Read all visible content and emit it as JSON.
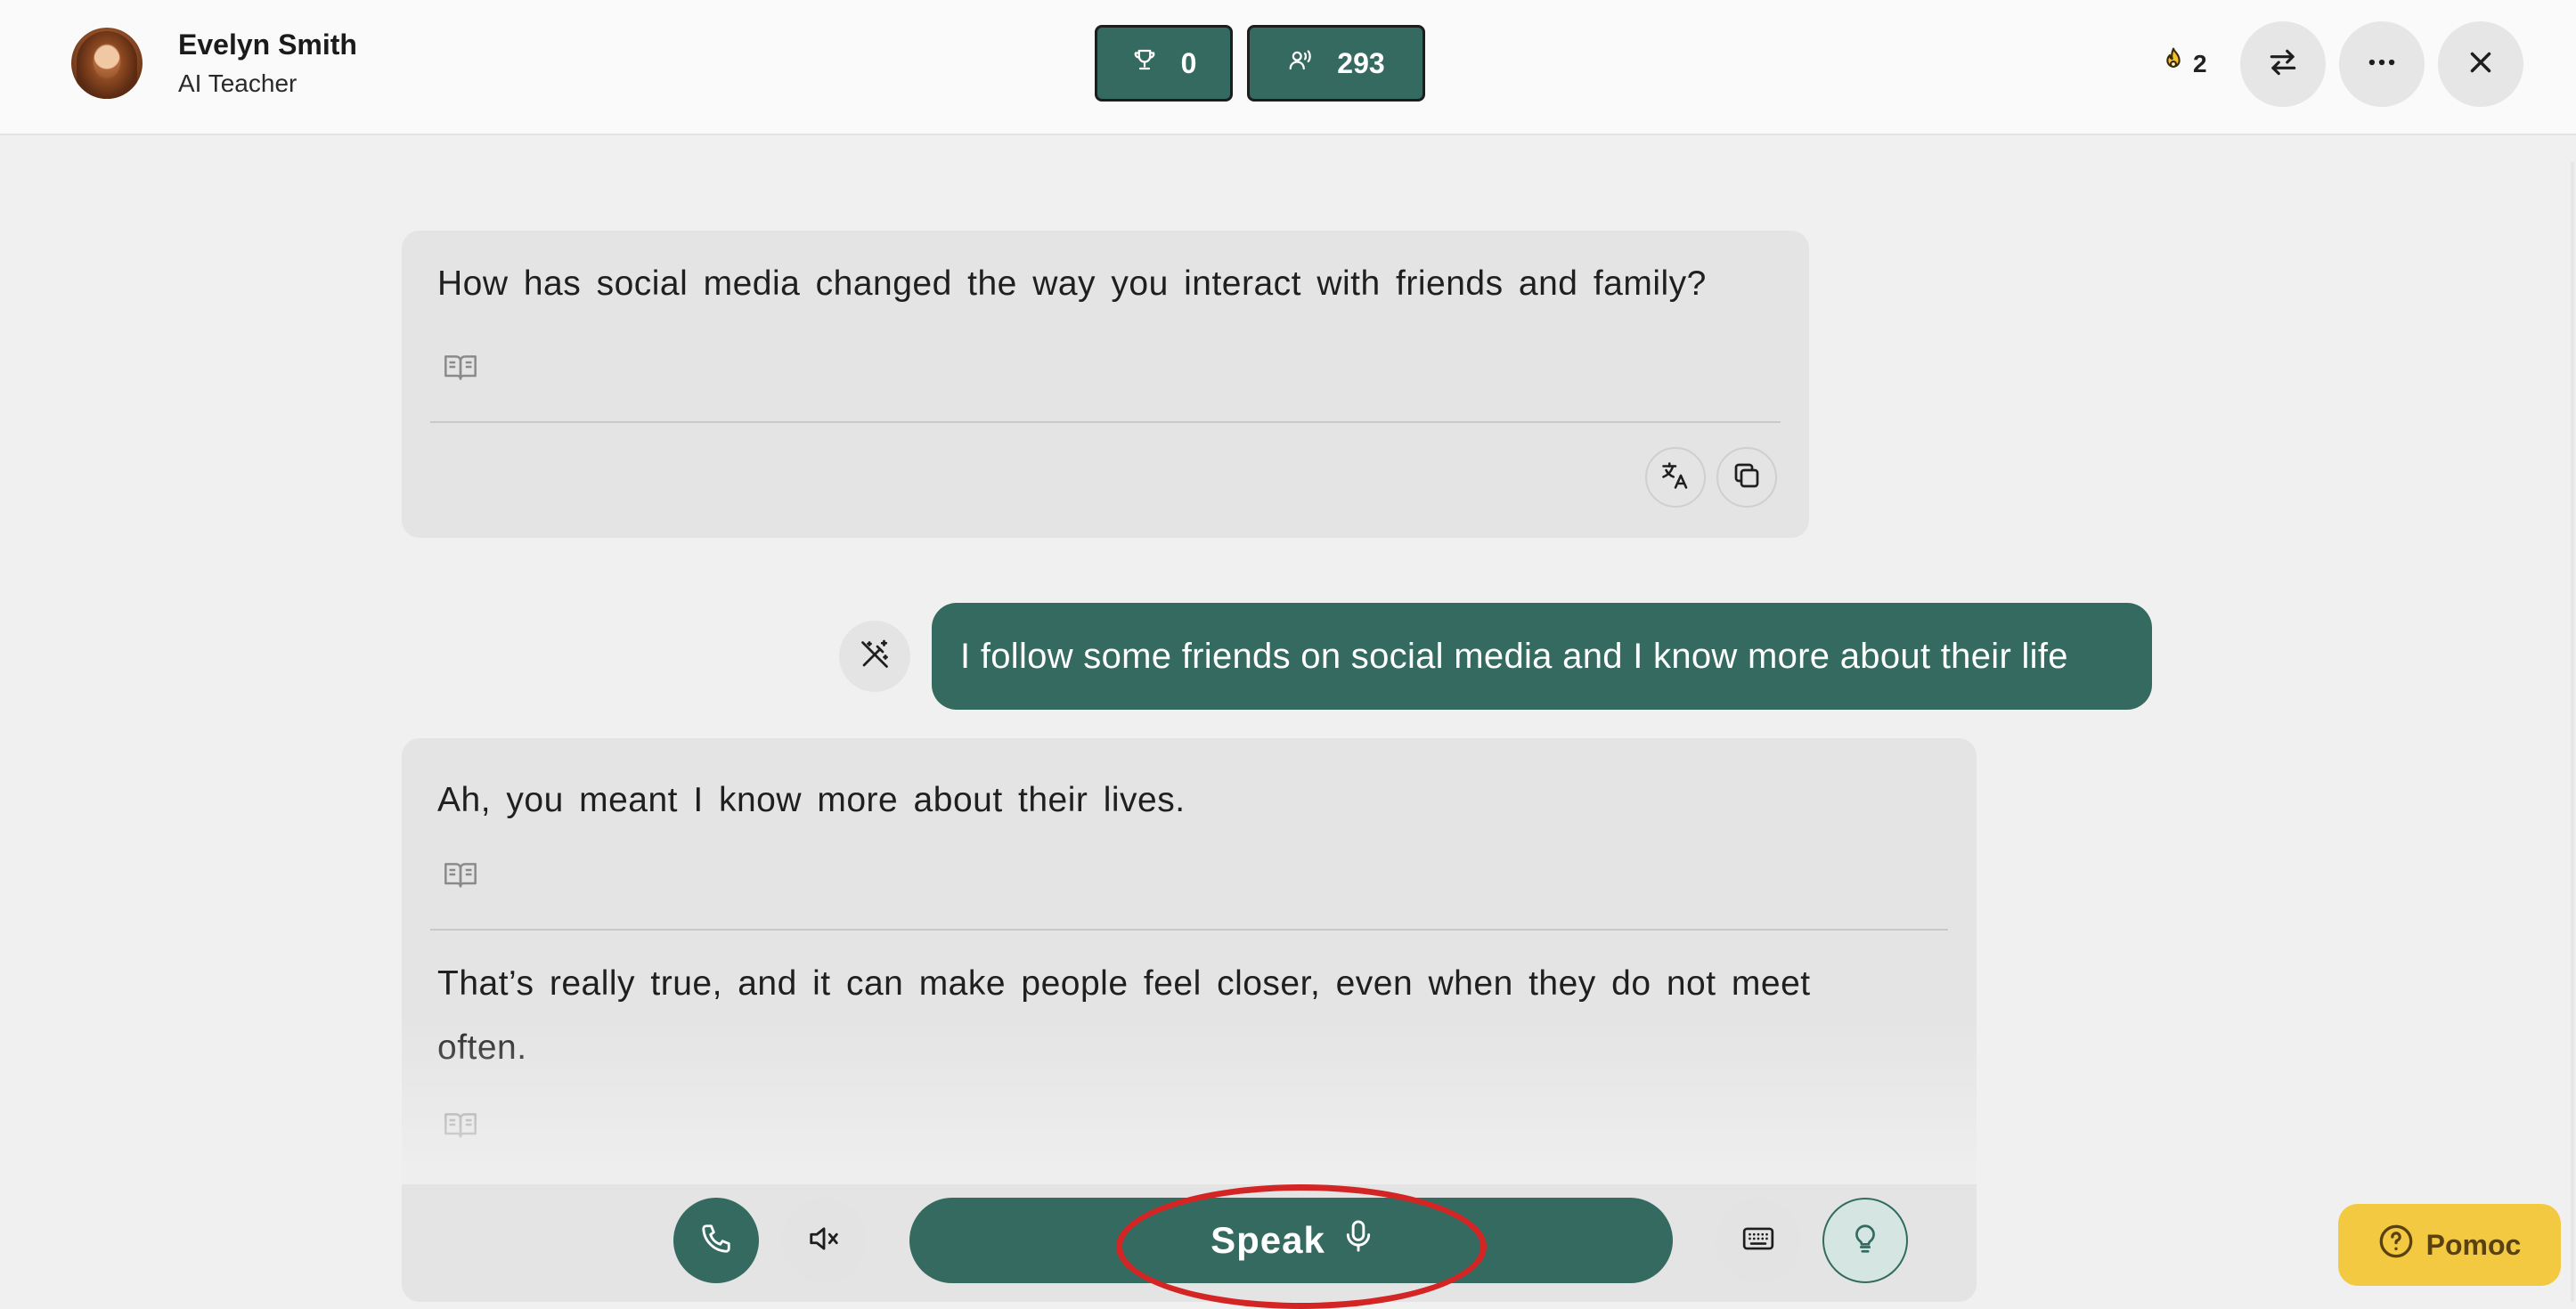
{
  "header": {
    "teacher_name": "Evelyn Smith",
    "teacher_role": "AI Teacher",
    "trophy_count": "0",
    "listen_count": "293",
    "streak_count": "2"
  },
  "chat": {
    "messages": [
      {
        "sender": "ai",
        "paragraphs": [
          "How has social media changed the way you interact with friends and family?"
        ]
      },
      {
        "sender": "user",
        "text": "I follow some friends on social media and I know more about their life"
      },
      {
        "sender": "ai",
        "correction": "Ah, you meant I know more about their lives.",
        "paragraphs": [
          "That’s really true, and it can make people feel closer, even when they do not meet often."
        ]
      }
    ]
  },
  "controls": {
    "speak_label": "Speak",
    "help_label": "Pomoc"
  },
  "colors": {
    "accent": "#356a61",
    "help": "#f4c942",
    "annotation": "#d42525"
  }
}
